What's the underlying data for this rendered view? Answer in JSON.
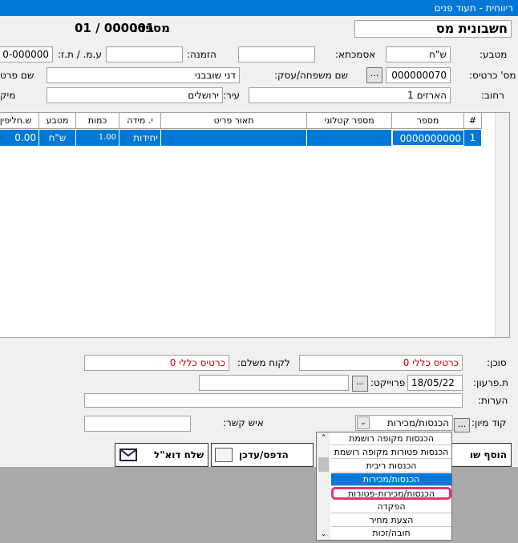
{
  "window": {
    "title": "ריווחית - תעוד פנים"
  },
  "header": {
    "doc_type": "חשבונית מס",
    "number_label": "מספר:",
    "number_value": "01 / 000001"
  },
  "fields": {
    "currency_label": "מטבע:",
    "currency_value": "ש\"ח",
    "asmachta_label": "אסמכתא:",
    "asmachta_value": "",
    "order_label": "הזמנה:",
    "order_value": "",
    "vat_label": "ע.מ. / ת.ז:",
    "vat_value": "0-000000",
    "card_label": "מס' כרטיס:",
    "card_value": "000000070",
    "family_label": "שם משפחה/עסק:",
    "family_value": "דני שובבני",
    "firstname_label": "שם פרט",
    "street_label": "רחוב:",
    "street_value": "הארזים 1",
    "city_label": "עיר:",
    "city_value": "ירושלים",
    "zip_label": "מיק"
  },
  "grid": {
    "headers": {
      "num": "#",
      "sku": "מספר",
      "catalog": "מספר קטלוגי",
      "desc": "תאור פריט",
      "unit": "י. מידה",
      "qty": "כמות",
      "currency": "מטבע",
      "fx": "ש.חליפין"
    },
    "row": {
      "num": "1",
      "sku": "0000000000",
      "catalog": "",
      "desc": "",
      "unit": "יחידות",
      "qty": "1.00",
      "currency": "ש\"ח",
      "fx": "0.00"
    }
  },
  "footer": {
    "agent_label": "סוכן:",
    "agent_value": "כרטיס כללי 0",
    "payer_label": "לקוח משלם:",
    "payer_value": "כרטיס כללי 0",
    "due_label": "ת.פרעון:",
    "due_value": "18/05/22",
    "project_label": "פרוייקט:",
    "project_value": "",
    "notes_label": "הערות:",
    "notes_value": "",
    "sort_label": "קוד מיון:",
    "sort_value": "הכנסות/מכירות",
    "contact_label": "איש קשר:",
    "contact_value": ""
  },
  "buttons": {
    "add": "הוסף שו",
    "print": "הדפס/עדכן",
    "email": "שלח דוא\"ל"
  },
  "dropdown": {
    "items": [
      "הכנסות מקופה רושמת",
      "הכנסות פטורות מקופה רושמת",
      "הכנסות ריבית",
      "הכנסות/מכירות",
      "הכנסות/מכירות-פטורות",
      "הפקדה",
      "הצעת מחיר",
      "חובה/זכות"
    ],
    "selected_index": 3,
    "highlighted_index": 4
  },
  "colors": {
    "accent": "#0078d7",
    "highlight": "#e8336b",
    "red_text": "#c00000"
  }
}
